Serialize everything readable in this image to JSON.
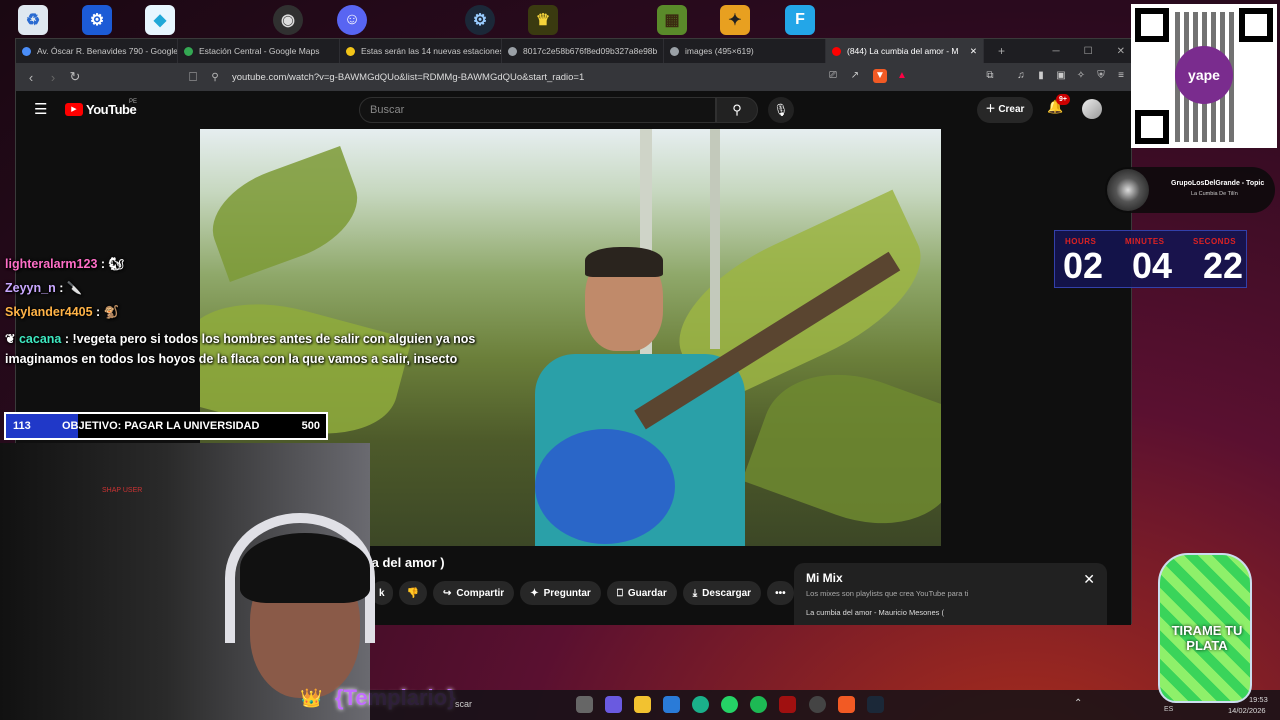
{
  "browser": {
    "tabs": [
      {
        "label": "Av. Óscar R. Benavides 790 - Google",
        "color": "#4a8df8"
      },
      {
        "label": "Estación Central - Google Maps",
        "color": "#34a853"
      },
      {
        "label": "Estas serán las 14 nuevas estaciones",
        "color": "#f2c418"
      },
      {
        "label": "8017c2e58b676f8ed09b327a8e98b",
        "color": "#9aa0a6"
      },
      {
        "label": "images (495×619)",
        "color": "#9aa0a6"
      },
      {
        "label": "(844) La cumbia del amor - M",
        "color": "#ff0000"
      }
    ],
    "url": "youtube.com/watch?v=g-BAWMGdQUo&list=RDMMg-BAWMGdQUo&start_radio=1"
  },
  "youtube": {
    "logo": "YouTube",
    "region": "PE",
    "search_placeholder": "Buscar",
    "create_label": "Crear",
    "notif_count": "9+",
    "video_title": "la del amor )",
    "actions": [
      {
        "label": "k",
        "icon": "thumb-icon"
      },
      {
        "label": "",
        "icon": "dislike-icon"
      },
      {
        "label": "Compartir",
        "icon": "share-icon"
      },
      {
        "label": "Preguntar",
        "icon": "sparkle-icon"
      },
      {
        "label": "Guardar",
        "icon": "bookmark-icon"
      },
      {
        "label": "Descargar",
        "icon": "download-icon"
      },
      {
        "label": "•••",
        "icon": "more-icon"
      }
    ],
    "mix": {
      "title": "Mi Mix",
      "subtitle": "Los mixes son playlists que crea YouTube para ti",
      "item": "La cumbia del amor - Mauricio Mesones ("
    }
  },
  "chat": [
    {
      "user": "lighteralarm123",
      "msg": "",
      "color": "#ff6ec7"
    },
    {
      "user": "Zeyyn_n",
      "msg": "",
      "color": "#c9a8ff"
    },
    {
      "user": "Skylander4405",
      "msg": "",
      "color": "#ffb347"
    },
    {
      "user": "cacana",
      "msg": "!vegeta pero si todos los hombres antes de salir con alguien ya nos imaginamos en todos los hoyos de la flaca con la que vamos a salir, insecto",
      "color": "#3ee8c0"
    }
  ],
  "goal": {
    "current": "113",
    "label": "OBJETIVO: PAGAR LA UNIVERSIDAD",
    "target": "500",
    "progress": 0.226
  },
  "now_playing": {
    "artist": "GrupoLosDelGrande - Topic",
    "song": "La Cumbia De Tilín"
  },
  "timer": {
    "hours_label": "HOURS",
    "minutes_label": "MINUTES",
    "seconds_label": "SECONDS",
    "hours": "02",
    "minutes": "04",
    "seconds": "22"
  },
  "overlay": {
    "username": "{Templario}",
    "cam_sign": "SHAP USER",
    "tirame": "TIRAME TU PLATA",
    "qr_brand": "yape"
  },
  "taskbar": {
    "search": "scar",
    "lang": "ES",
    "time": "19:53",
    "date": "14/02/2026"
  }
}
